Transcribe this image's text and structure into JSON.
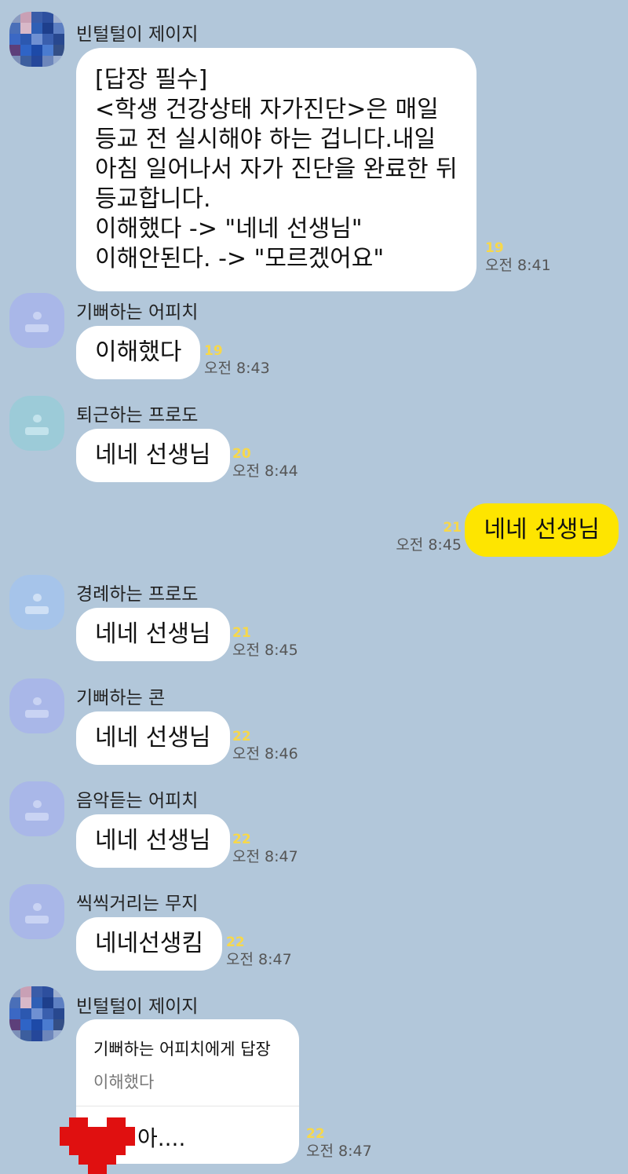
{
  "chat": {
    "messages": [
      {
        "sender": "빈털털이 제이지",
        "lines": [
          "[답장 필수]",
          "<학생 건강상태 자가진단>은 매일",
          "등교 전 실시해야 하는 겁니다.내일",
          "아침 일어나서 자가 진단을 완료한 뒤",
          "등교합니다.",
          "이해했다 -> \"네네 선생님\"",
          "이해안된다. -> \"모르겠어요\""
        ],
        "unread": "19",
        "time": "오전 8:41"
      },
      {
        "sender": "기뻐하는 어피치",
        "text": "이해했다",
        "unread": "19",
        "time": "오전 8:43"
      },
      {
        "sender": "퇴근하는 프로도",
        "text": "네네 선생님",
        "unread": "20",
        "time": "오전 8:44"
      },
      {
        "sender": "",
        "text": "네네 선생님",
        "unread": "21",
        "time": "오전 8:45"
      },
      {
        "sender": "경례하는 프로도",
        "text": "네네 선생님",
        "unread": "21",
        "time": "오전 8:45"
      },
      {
        "sender": "기뻐하는 콘",
        "text": "네네 선생님",
        "unread": "22",
        "time": "오전 8:46"
      },
      {
        "sender": "음악듣는 어피치",
        "text": "네네 선생님",
        "unread": "22",
        "time": "오전 8:47"
      },
      {
        "sender": "씩씩거리는 무지",
        "text": "네네선생킴",
        "unread": "22",
        "time": "오전 8:47"
      },
      {
        "sender": "빈털털이 제이지",
        "reply_to": "기뻐하는 어피치에게 답장",
        "quote": "이해했다",
        "text": "아....",
        "unread": "22",
        "time": "오전 8:47"
      }
    ]
  },
  "colors": {
    "background": "#b2c7da",
    "my_bubble": "#fee500",
    "other_bubble": "#ffffff",
    "unread_count": "#f7d84a"
  },
  "icons": {
    "default_avatar": "person-placeholder-icon",
    "censor_heart": "pixel-heart-icon"
  }
}
